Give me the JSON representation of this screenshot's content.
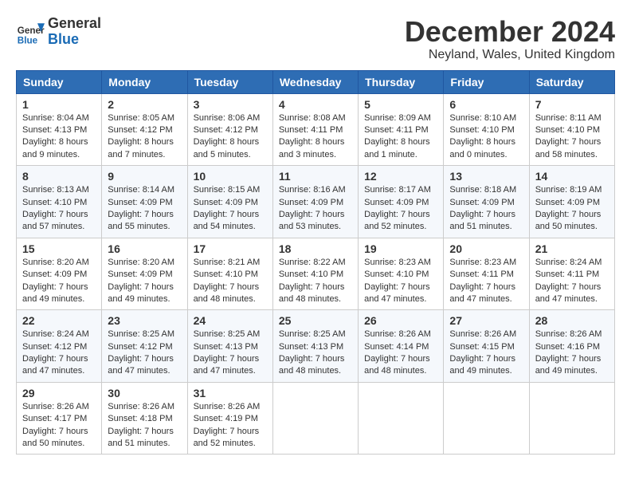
{
  "header": {
    "logo_general": "General",
    "logo_blue": "Blue",
    "month_title": "December 2024",
    "location": "Neyland, Wales, United Kingdom"
  },
  "weekdays": [
    "Sunday",
    "Monday",
    "Tuesday",
    "Wednesday",
    "Thursday",
    "Friday",
    "Saturday"
  ],
  "weeks": [
    [
      {
        "day": "1",
        "sunrise": "8:04 AM",
        "sunset": "4:13 PM",
        "daylight": "8 hours and 9 minutes."
      },
      {
        "day": "2",
        "sunrise": "8:05 AM",
        "sunset": "4:12 PM",
        "daylight": "8 hours and 7 minutes."
      },
      {
        "day": "3",
        "sunrise": "8:06 AM",
        "sunset": "4:12 PM",
        "daylight": "8 hours and 5 minutes."
      },
      {
        "day": "4",
        "sunrise": "8:08 AM",
        "sunset": "4:11 PM",
        "daylight": "8 hours and 3 minutes."
      },
      {
        "day": "5",
        "sunrise": "8:09 AM",
        "sunset": "4:11 PM",
        "daylight": "8 hours and 1 minute."
      },
      {
        "day": "6",
        "sunrise": "8:10 AM",
        "sunset": "4:10 PM",
        "daylight": "8 hours and 0 minutes."
      },
      {
        "day": "7",
        "sunrise": "8:11 AM",
        "sunset": "4:10 PM",
        "daylight": "7 hours and 58 minutes."
      }
    ],
    [
      {
        "day": "8",
        "sunrise": "8:13 AM",
        "sunset": "4:10 PM",
        "daylight": "7 hours and 57 minutes."
      },
      {
        "day": "9",
        "sunrise": "8:14 AM",
        "sunset": "4:09 PM",
        "daylight": "7 hours and 55 minutes."
      },
      {
        "day": "10",
        "sunrise": "8:15 AM",
        "sunset": "4:09 PM",
        "daylight": "7 hours and 54 minutes."
      },
      {
        "day": "11",
        "sunrise": "8:16 AM",
        "sunset": "4:09 PM",
        "daylight": "7 hours and 53 minutes."
      },
      {
        "day": "12",
        "sunrise": "8:17 AM",
        "sunset": "4:09 PM",
        "daylight": "7 hours and 52 minutes."
      },
      {
        "day": "13",
        "sunrise": "8:18 AM",
        "sunset": "4:09 PM",
        "daylight": "7 hours and 51 minutes."
      },
      {
        "day": "14",
        "sunrise": "8:19 AM",
        "sunset": "4:09 PM",
        "daylight": "7 hours and 50 minutes."
      }
    ],
    [
      {
        "day": "15",
        "sunrise": "8:20 AM",
        "sunset": "4:09 PM",
        "daylight": "7 hours and 49 minutes."
      },
      {
        "day": "16",
        "sunrise": "8:20 AM",
        "sunset": "4:09 PM",
        "daylight": "7 hours and 49 minutes."
      },
      {
        "day": "17",
        "sunrise": "8:21 AM",
        "sunset": "4:10 PM",
        "daylight": "7 hours and 48 minutes."
      },
      {
        "day": "18",
        "sunrise": "8:22 AM",
        "sunset": "4:10 PM",
        "daylight": "7 hours and 48 minutes."
      },
      {
        "day": "19",
        "sunrise": "8:23 AM",
        "sunset": "4:10 PM",
        "daylight": "7 hours and 47 minutes."
      },
      {
        "day": "20",
        "sunrise": "8:23 AM",
        "sunset": "4:11 PM",
        "daylight": "7 hours and 47 minutes."
      },
      {
        "day": "21",
        "sunrise": "8:24 AM",
        "sunset": "4:11 PM",
        "daylight": "7 hours and 47 minutes."
      }
    ],
    [
      {
        "day": "22",
        "sunrise": "8:24 AM",
        "sunset": "4:12 PM",
        "daylight": "7 hours and 47 minutes."
      },
      {
        "day": "23",
        "sunrise": "8:25 AM",
        "sunset": "4:12 PM",
        "daylight": "7 hours and 47 minutes."
      },
      {
        "day": "24",
        "sunrise": "8:25 AM",
        "sunset": "4:13 PM",
        "daylight": "7 hours and 47 minutes."
      },
      {
        "day": "25",
        "sunrise": "8:25 AM",
        "sunset": "4:13 PM",
        "daylight": "7 hours and 48 minutes."
      },
      {
        "day": "26",
        "sunrise": "8:26 AM",
        "sunset": "4:14 PM",
        "daylight": "7 hours and 48 minutes."
      },
      {
        "day": "27",
        "sunrise": "8:26 AM",
        "sunset": "4:15 PM",
        "daylight": "7 hours and 49 minutes."
      },
      {
        "day": "28",
        "sunrise": "8:26 AM",
        "sunset": "4:16 PM",
        "daylight": "7 hours and 49 minutes."
      }
    ],
    [
      {
        "day": "29",
        "sunrise": "8:26 AM",
        "sunset": "4:17 PM",
        "daylight": "7 hours and 50 minutes."
      },
      {
        "day": "30",
        "sunrise": "8:26 AM",
        "sunset": "4:18 PM",
        "daylight": "7 hours and 51 minutes."
      },
      {
        "day": "31",
        "sunrise": "8:26 AM",
        "sunset": "4:19 PM",
        "daylight": "7 hours and 52 minutes."
      },
      null,
      null,
      null,
      null
    ]
  ]
}
